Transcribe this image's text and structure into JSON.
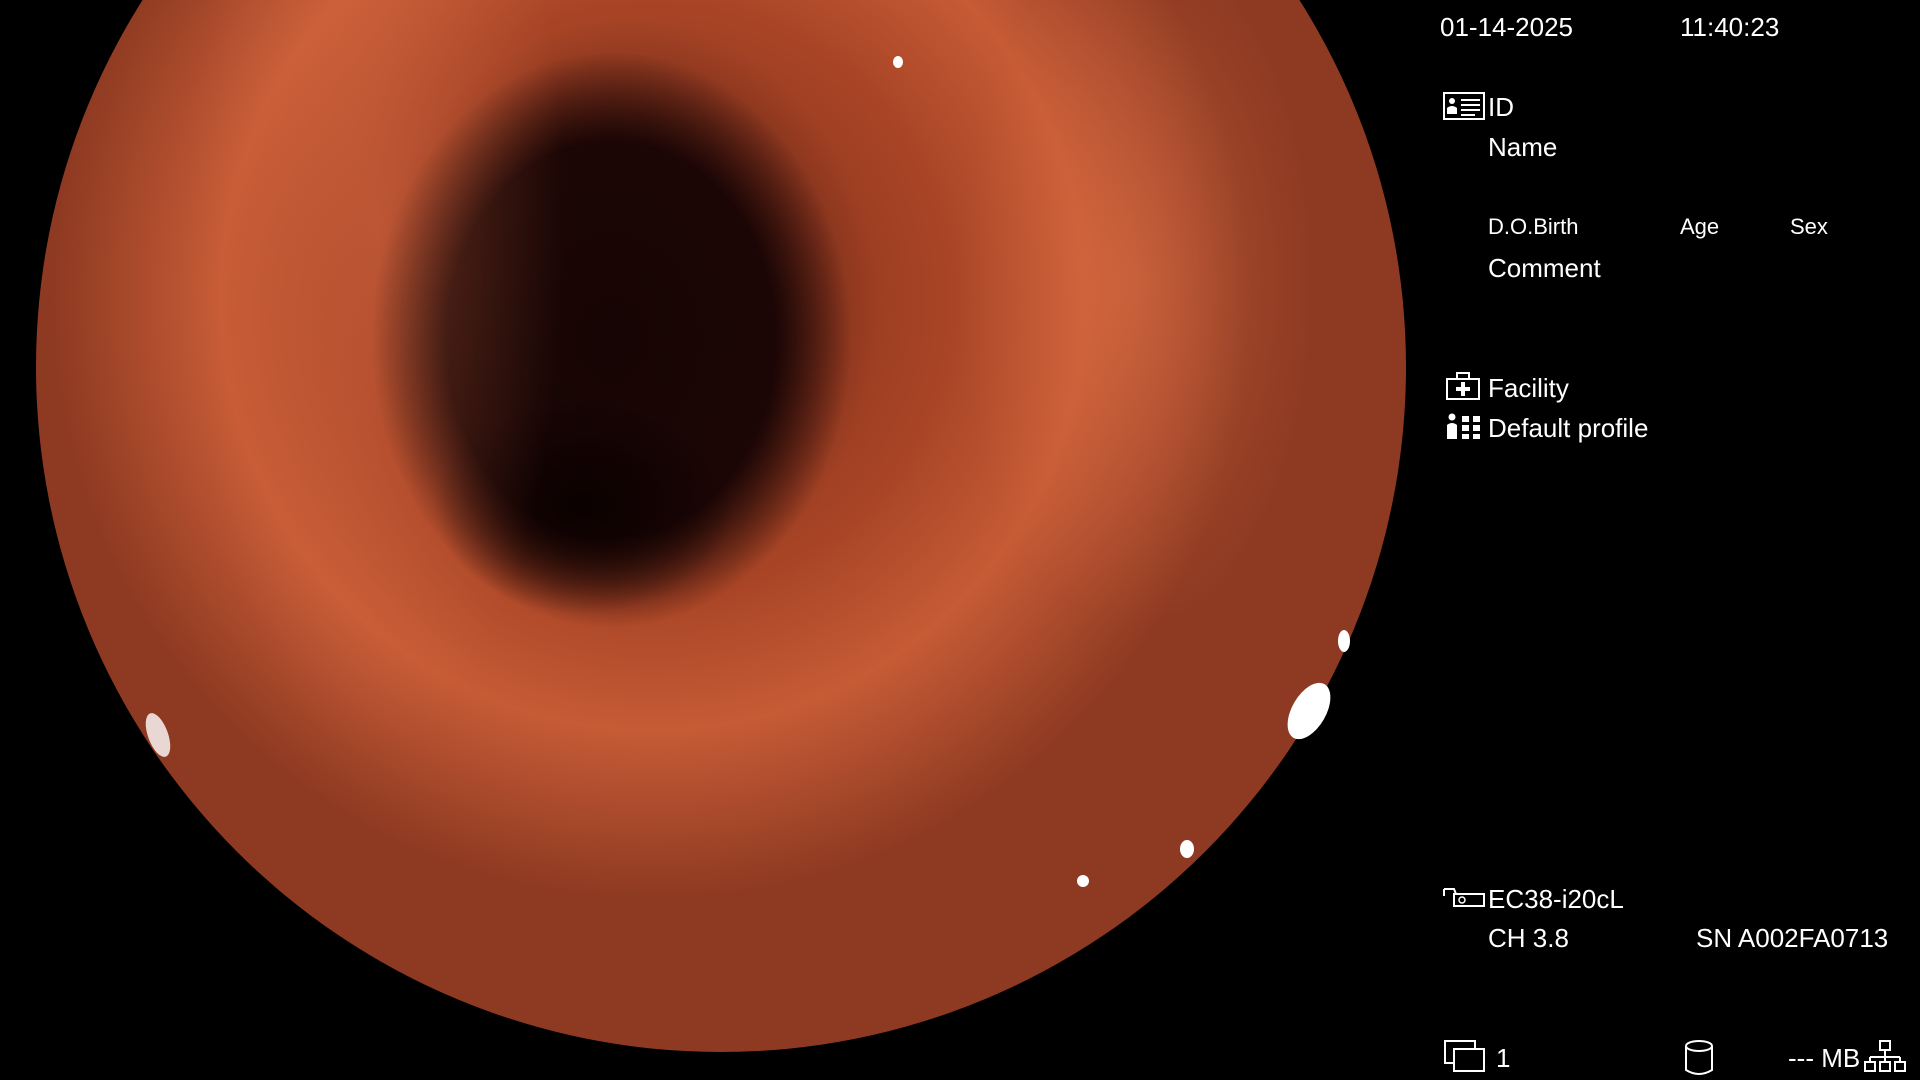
{
  "header": {
    "date": "01-14-2025",
    "time": "11:40:23"
  },
  "patient": {
    "id_label": "ID",
    "name_label": "Name",
    "dob_label": "D.O.Birth",
    "age_label": "Age",
    "sex_label": "Sex",
    "comment_label": "Comment"
  },
  "facility": {
    "label": "Facility",
    "profile": "Default profile"
  },
  "scope": {
    "model": "EC38-i20cL",
    "channel": "CH 3.8",
    "serial": "SN A002FA0713"
  },
  "footer": {
    "image_count": "1",
    "storage": "--- MB"
  },
  "icons": {
    "id": "id-card-icon",
    "facility": "medical-kit-icon",
    "profile": "user-profile-icon",
    "scope": "endoscope-icon",
    "images": "image-stack-icon",
    "storage": "storage-cylinder-icon",
    "network": "network-icon"
  }
}
